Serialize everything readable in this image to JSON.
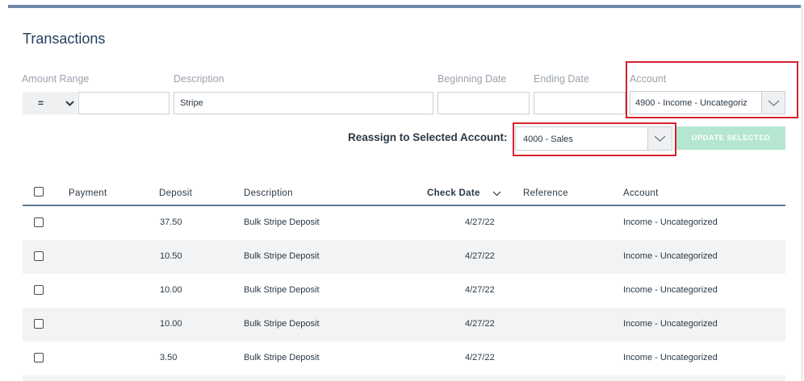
{
  "page": {
    "title": "Transactions"
  },
  "filters": {
    "amount_range_label": "Amount Range",
    "amount_operator": "=",
    "amount_value": "",
    "description_label": "Description",
    "description_value": "Stripe",
    "beginning_date_label": "Beginning Date",
    "beginning_date_value": "",
    "ending_date_label": "Ending Date",
    "ending_date_value": "",
    "account_label": "Account",
    "account_value": "4900 - Income - Uncategoriz"
  },
  "reassign": {
    "label": "Reassign to Selected Account:",
    "selected": "4000 - Sales",
    "button_label": "UPDATE SELECTED"
  },
  "table": {
    "headers": {
      "payment": "Payment",
      "deposit": "Deposit",
      "description": "Description",
      "check_date": "Check Date",
      "reference": "Reference",
      "account": "Account"
    },
    "sort": {
      "column": "check_date",
      "direction": "descending"
    },
    "rows": [
      {
        "payment": "",
        "deposit": "37.50",
        "description": "Bulk Stripe Deposit",
        "check_date": "4/27/22",
        "reference": "",
        "account": "Income - Uncategorized"
      },
      {
        "payment": "",
        "deposit": "10.50",
        "description": "Bulk Stripe Deposit",
        "check_date": "4/27/22",
        "reference": "",
        "account": "Income - Uncategorized"
      },
      {
        "payment": "",
        "deposit": "10.00",
        "description": "Bulk Stripe Deposit",
        "check_date": "4/27/22",
        "reference": "",
        "account": "Income - Uncategorized"
      },
      {
        "payment": "",
        "deposit": "10.00",
        "description": "Bulk Stripe Deposit",
        "check_date": "4/27/22",
        "reference": "",
        "account": "Income - Uncategorized"
      },
      {
        "payment": "",
        "deposit": "3.50",
        "description": "Bulk Stripe Deposit",
        "check_date": "4/27/22",
        "reference": "",
        "account": "Income - Uncategorized"
      }
    ]
  },
  "colors": {
    "highlight": "#d8202f",
    "update_button_bg": "#b4e6d2",
    "header_rule": "#5d738e",
    "top_bar": "#6f86a6"
  },
  "icons": {
    "operator_dropdown": "chevron-down-icon",
    "account_dropdown": "chevron-down-icon",
    "sort_indicator": "chevron-down-icon",
    "row_select": "checkbox-icon"
  }
}
